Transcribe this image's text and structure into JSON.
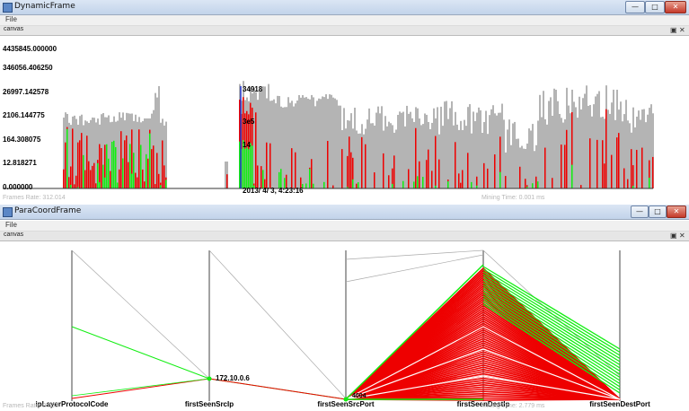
{
  "top_window": {
    "title": "DynamicFrame",
    "menu": "File",
    "canvas_label": "canvas",
    "minimize_glyph": "—",
    "maximize_glyph": "□",
    "close_glyph": "✕",
    "canvas_restore_glyph": "▣",
    "canvas_close_glyph": "✕",
    "frames_rate": "Frames Rate: 312.014",
    "mining_time": "Mining Time: 0.001 ms"
  },
  "bottom_window": {
    "title": "ParaCoordFrame",
    "menu": "File",
    "canvas_label": "canvas",
    "minimize_glyph": "—",
    "maximize_glyph": "□",
    "close_glyph": "✕",
    "canvas_restore_glyph": "▣",
    "canvas_close_glyph": "✕",
    "frames_rate": "Frames Rate: 0.503",
    "mining_time": "Mining Time: 2.779 ms"
  },
  "colors": {
    "gray": "#b4b4b4",
    "red": "#ee0000",
    "green": "#11ee11",
    "cursor": "#2233cc"
  },
  "chart_data": [
    {
      "type": "bar",
      "scale": "log",
      "yticks": [
        "4435845.000000",
        "346056.406250",
        "26997.142578",
        "2106.144775",
        "164.308075",
        "12.818271",
        "0.000000"
      ],
      "series": [
        {
          "color": "gray"
        },
        {
          "color": "red"
        },
        {
          "color": "green"
        }
      ],
      "cursor_labels": {
        "total": "34918",
        "red": "3e5",
        "green": "14",
        "timestamp": "2013/ 4/ 3, 4:23:16"
      }
    },
    {
      "type": "parallel-coordinates",
      "axes": [
        "ipLayerProtocolCode",
        "firstSeenSrcIp",
        "firstSeenSrcPort",
        "firstSeenDestIp",
        "firstSeenDestPort"
      ],
      "annotations": {
        "src_ip": "172.10.0.6",
        "src_port": "4004"
      }
    }
  ]
}
